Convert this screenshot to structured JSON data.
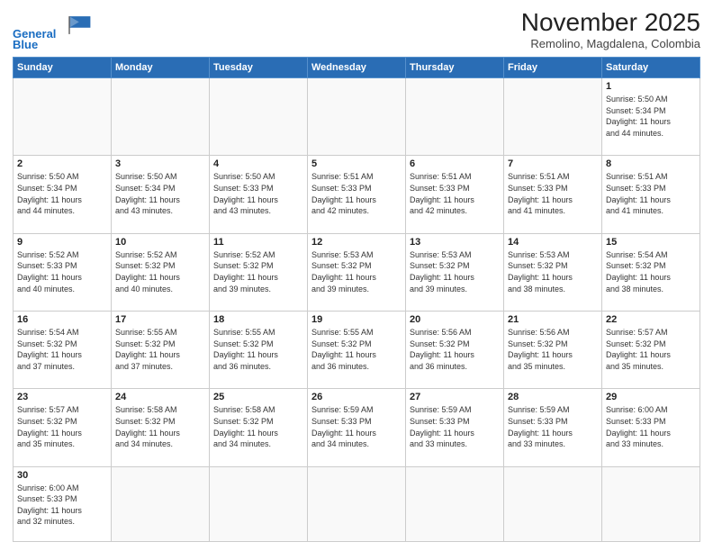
{
  "header": {
    "logo_line1": "General",
    "logo_line2": "Blue",
    "month_title": "November 2025",
    "location": "Remolino, Magdalena, Colombia"
  },
  "weekdays": [
    "Sunday",
    "Monday",
    "Tuesday",
    "Wednesday",
    "Thursday",
    "Friday",
    "Saturday"
  ],
  "weeks": [
    [
      {
        "day": "",
        "info": ""
      },
      {
        "day": "",
        "info": ""
      },
      {
        "day": "",
        "info": ""
      },
      {
        "day": "",
        "info": ""
      },
      {
        "day": "",
        "info": ""
      },
      {
        "day": "",
        "info": ""
      },
      {
        "day": "1",
        "info": "Sunrise: 5:50 AM\nSunset: 5:34 PM\nDaylight: 11 hours\nand 44 minutes."
      }
    ],
    [
      {
        "day": "2",
        "info": "Sunrise: 5:50 AM\nSunset: 5:34 PM\nDaylight: 11 hours\nand 44 minutes."
      },
      {
        "day": "3",
        "info": "Sunrise: 5:50 AM\nSunset: 5:34 PM\nDaylight: 11 hours\nand 43 minutes."
      },
      {
        "day": "4",
        "info": "Sunrise: 5:50 AM\nSunset: 5:33 PM\nDaylight: 11 hours\nand 43 minutes."
      },
      {
        "day": "5",
        "info": "Sunrise: 5:51 AM\nSunset: 5:33 PM\nDaylight: 11 hours\nand 42 minutes."
      },
      {
        "day": "6",
        "info": "Sunrise: 5:51 AM\nSunset: 5:33 PM\nDaylight: 11 hours\nand 42 minutes."
      },
      {
        "day": "7",
        "info": "Sunrise: 5:51 AM\nSunset: 5:33 PM\nDaylight: 11 hours\nand 41 minutes."
      },
      {
        "day": "8",
        "info": "Sunrise: 5:51 AM\nSunset: 5:33 PM\nDaylight: 11 hours\nand 41 minutes."
      }
    ],
    [
      {
        "day": "9",
        "info": "Sunrise: 5:52 AM\nSunset: 5:33 PM\nDaylight: 11 hours\nand 40 minutes."
      },
      {
        "day": "10",
        "info": "Sunrise: 5:52 AM\nSunset: 5:32 PM\nDaylight: 11 hours\nand 40 minutes."
      },
      {
        "day": "11",
        "info": "Sunrise: 5:52 AM\nSunset: 5:32 PM\nDaylight: 11 hours\nand 39 minutes."
      },
      {
        "day": "12",
        "info": "Sunrise: 5:53 AM\nSunset: 5:32 PM\nDaylight: 11 hours\nand 39 minutes."
      },
      {
        "day": "13",
        "info": "Sunrise: 5:53 AM\nSunset: 5:32 PM\nDaylight: 11 hours\nand 39 minutes."
      },
      {
        "day": "14",
        "info": "Sunrise: 5:53 AM\nSunset: 5:32 PM\nDaylight: 11 hours\nand 38 minutes."
      },
      {
        "day": "15",
        "info": "Sunrise: 5:54 AM\nSunset: 5:32 PM\nDaylight: 11 hours\nand 38 minutes."
      }
    ],
    [
      {
        "day": "16",
        "info": "Sunrise: 5:54 AM\nSunset: 5:32 PM\nDaylight: 11 hours\nand 37 minutes."
      },
      {
        "day": "17",
        "info": "Sunrise: 5:55 AM\nSunset: 5:32 PM\nDaylight: 11 hours\nand 37 minutes."
      },
      {
        "day": "18",
        "info": "Sunrise: 5:55 AM\nSunset: 5:32 PM\nDaylight: 11 hours\nand 36 minutes."
      },
      {
        "day": "19",
        "info": "Sunrise: 5:55 AM\nSunset: 5:32 PM\nDaylight: 11 hours\nand 36 minutes."
      },
      {
        "day": "20",
        "info": "Sunrise: 5:56 AM\nSunset: 5:32 PM\nDaylight: 11 hours\nand 36 minutes."
      },
      {
        "day": "21",
        "info": "Sunrise: 5:56 AM\nSunset: 5:32 PM\nDaylight: 11 hours\nand 35 minutes."
      },
      {
        "day": "22",
        "info": "Sunrise: 5:57 AM\nSunset: 5:32 PM\nDaylight: 11 hours\nand 35 minutes."
      }
    ],
    [
      {
        "day": "23",
        "info": "Sunrise: 5:57 AM\nSunset: 5:32 PM\nDaylight: 11 hours\nand 35 minutes."
      },
      {
        "day": "24",
        "info": "Sunrise: 5:58 AM\nSunset: 5:32 PM\nDaylight: 11 hours\nand 34 minutes."
      },
      {
        "day": "25",
        "info": "Sunrise: 5:58 AM\nSunset: 5:32 PM\nDaylight: 11 hours\nand 34 minutes."
      },
      {
        "day": "26",
        "info": "Sunrise: 5:59 AM\nSunset: 5:33 PM\nDaylight: 11 hours\nand 34 minutes."
      },
      {
        "day": "27",
        "info": "Sunrise: 5:59 AM\nSunset: 5:33 PM\nDaylight: 11 hours\nand 33 minutes."
      },
      {
        "day": "28",
        "info": "Sunrise: 5:59 AM\nSunset: 5:33 PM\nDaylight: 11 hours\nand 33 minutes."
      },
      {
        "day": "29",
        "info": "Sunrise: 6:00 AM\nSunset: 5:33 PM\nDaylight: 11 hours\nand 33 minutes."
      }
    ],
    [
      {
        "day": "30",
        "info": "Sunrise: 6:00 AM\nSunset: 5:33 PM\nDaylight: 11 hours\nand 32 minutes."
      },
      {
        "day": "",
        "info": ""
      },
      {
        "day": "",
        "info": ""
      },
      {
        "day": "",
        "info": ""
      },
      {
        "day": "",
        "info": ""
      },
      {
        "day": "",
        "info": ""
      },
      {
        "day": "",
        "info": ""
      }
    ]
  ]
}
